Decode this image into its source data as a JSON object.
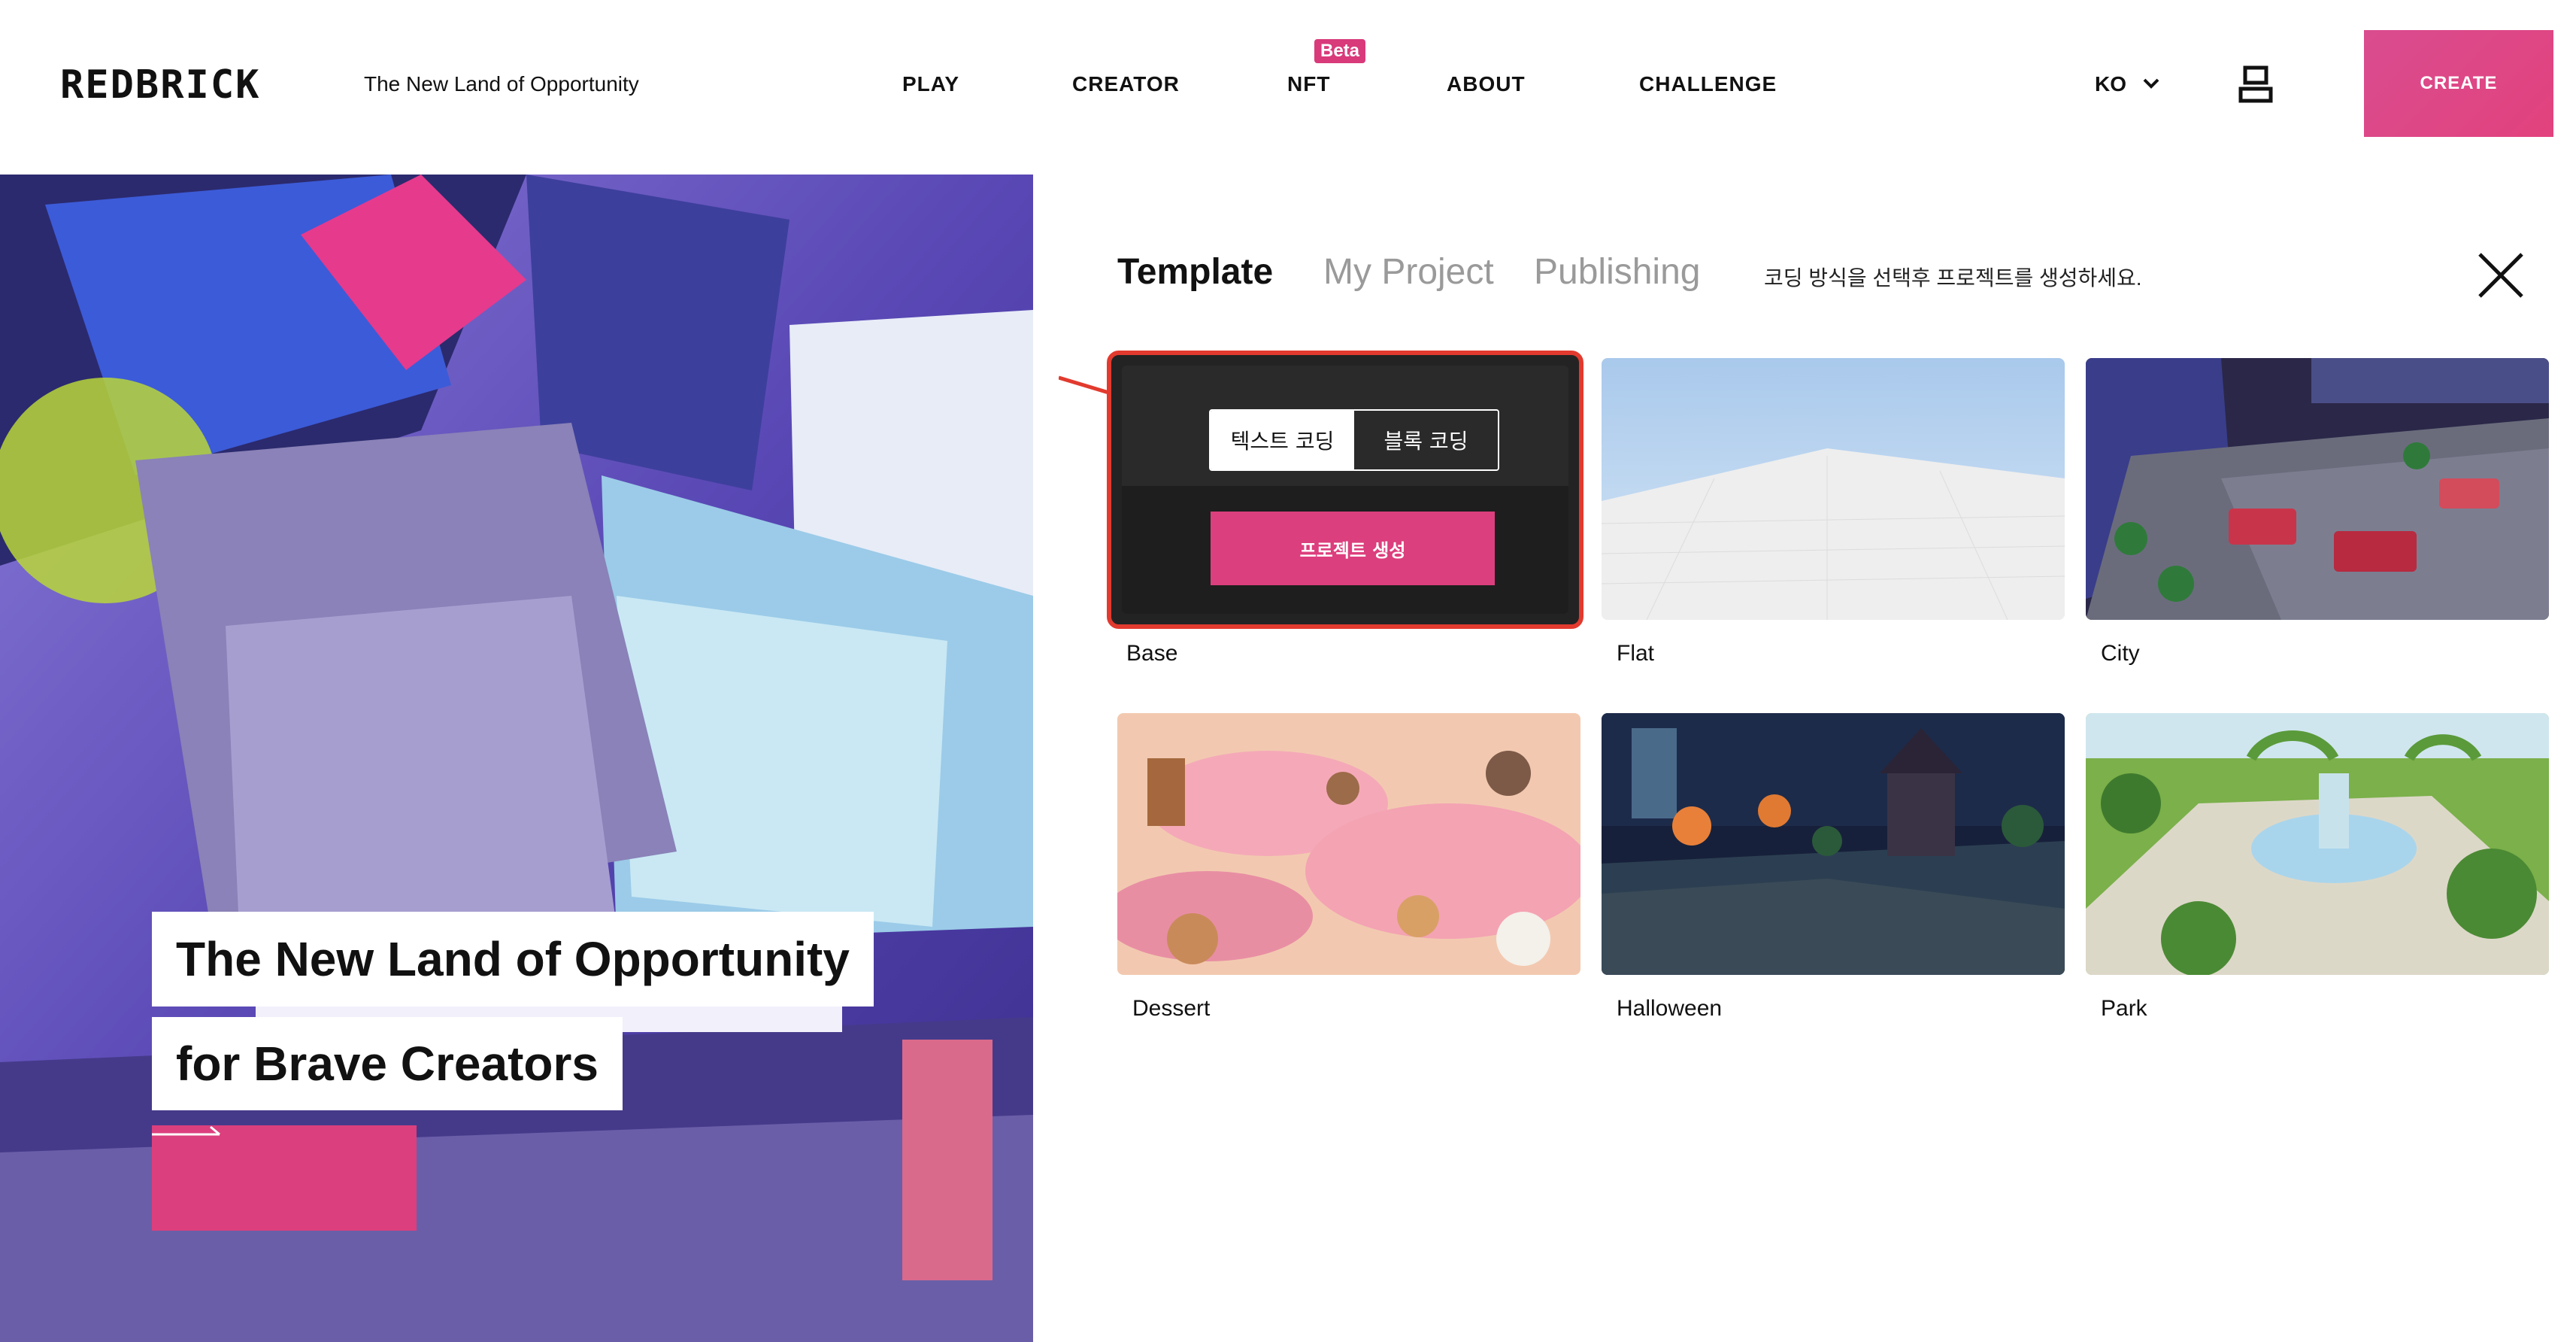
{
  "header": {
    "brand": "REDBRICK",
    "tagline": "The New Land of Opportunity",
    "nav": [
      {
        "label": "PLAY"
      },
      {
        "label": "CREATOR"
      },
      {
        "label": "NFT",
        "badge": "Beta"
      },
      {
        "label": "ABOUT"
      },
      {
        "label": "CHALLENGE"
      }
    ],
    "language": "KO",
    "create_label": "CREATE"
  },
  "hero": {
    "line1": "The New Land of Opportunity",
    "line2": "for Brave Creators"
  },
  "panel": {
    "tabs": [
      {
        "label": "Template",
        "active": true
      },
      {
        "label": "My Project",
        "active": false
      },
      {
        "label": "Publishing",
        "active": false
      }
    ],
    "hint": "코딩 방식을 선택후 프로젝트를 생성하세요.",
    "base_card": {
      "text_coding": "텍스트 코딩",
      "block_coding": "블록 코딩",
      "create_project": "프로젝트 생성"
    },
    "templates": [
      {
        "name": "Base"
      },
      {
        "name": "Flat"
      },
      {
        "name": "City"
      },
      {
        "name": "Dessert"
      },
      {
        "name": "Halloween"
      },
      {
        "name": "Park"
      }
    ]
  },
  "colors": {
    "accent_pink": "#dc3f7d",
    "highlight_red": "#e23a2e",
    "tab_inactive": "#9a9a9a"
  }
}
